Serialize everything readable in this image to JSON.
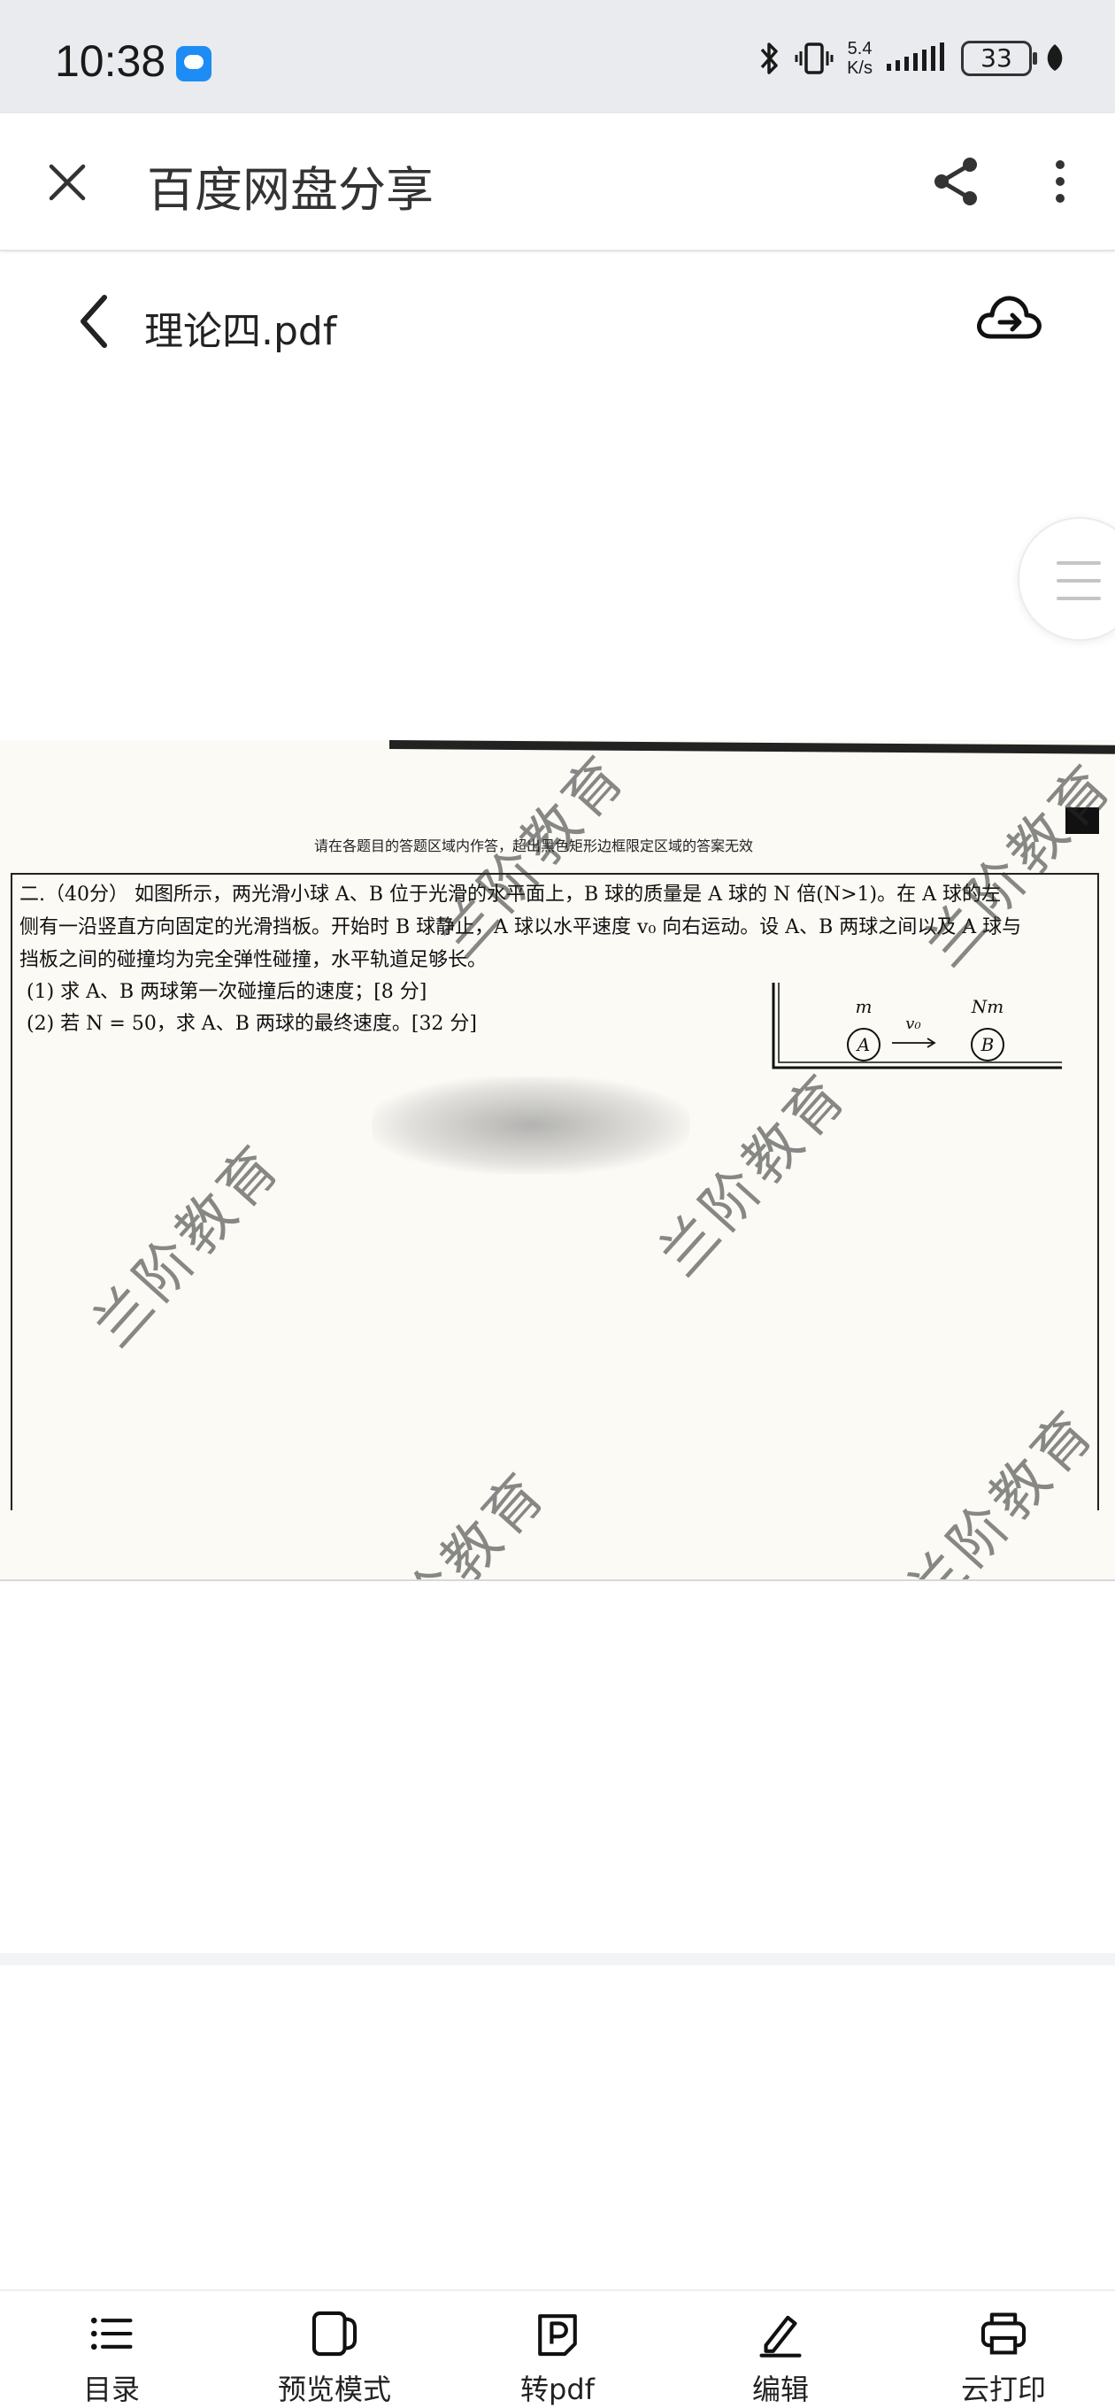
{
  "status_bar": {
    "time": "10:38",
    "net_speed_value": "5.4",
    "net_speed_unit": "K/s",
    "battery": "33",
    "icons": [
      "chat-bubble-icon",
      "bluetooth-icon",
      "vibrate-icon",
      "signal-icon",
      "battery-icon",
      "leaf-icon"
    ]
  },
  "app_header": {
    "title": "百度网盘分享",
    "icons": [
      "close-icon",
      "share-icon",
      "more-vertical-icon"
    ]
  },
  "file_header": {
    "file_name": "理论四.pdf",
    "icons": [
      "back-chevron-icon",
      "cloud-upload-icon"
    ]
  },
  "document": {
    "header_hint": "请在各题目的答题区域内作答，超出黑色矩形边框限定区域的答案无效",
    "question_lines": [
      "二.（40分） 如图所示，两光滑小球 A、B 位于光滑的水平面上，B 球的质量是 A 球的 N 倍(N>1)。在 A 球的左",
      "侧有一沿竖直方向固定的光滑挡板。开始时 B 球静止，A 球以水平速度 v₀ 向右运动。设 A、B 两球之间以及 A 球与",
      "挡板之间的碰撞均为完全弹性碰撞，水平轨道足够长。"
    ],
    "sub_questions": [
      "(1) 求 A、B 两球第一次碰撞后的速度；[8 分]",
      "(2) 若 N = 50，求 A、B 两球的最终速度。[32 分]"
    ],
    "diagram": {
      "mass_a": "m",
      "mass_b": "Nm",
      "velocity": "v₀",
      "ball_a": "A",
      "ball_b": "B"
    },
    "watermark": "兰阶教育"
  },
  "toolbar": {
    "items": [
      {
        "label": "目录",
        "icon": "list-icon"
      },
      {
        "label": "预览模式",
        "icon": "preview-mode-icon"
      },
      {
        "label": "转pdf",
        "icon": "pdf-convert-icon"
      },
      {
        "label": "编辑",
        "icon": "edit-pen-icon"
      },
      {
        "label": "云打印",
        "icon": "printer-icon"
      }
    ]
  }
}
